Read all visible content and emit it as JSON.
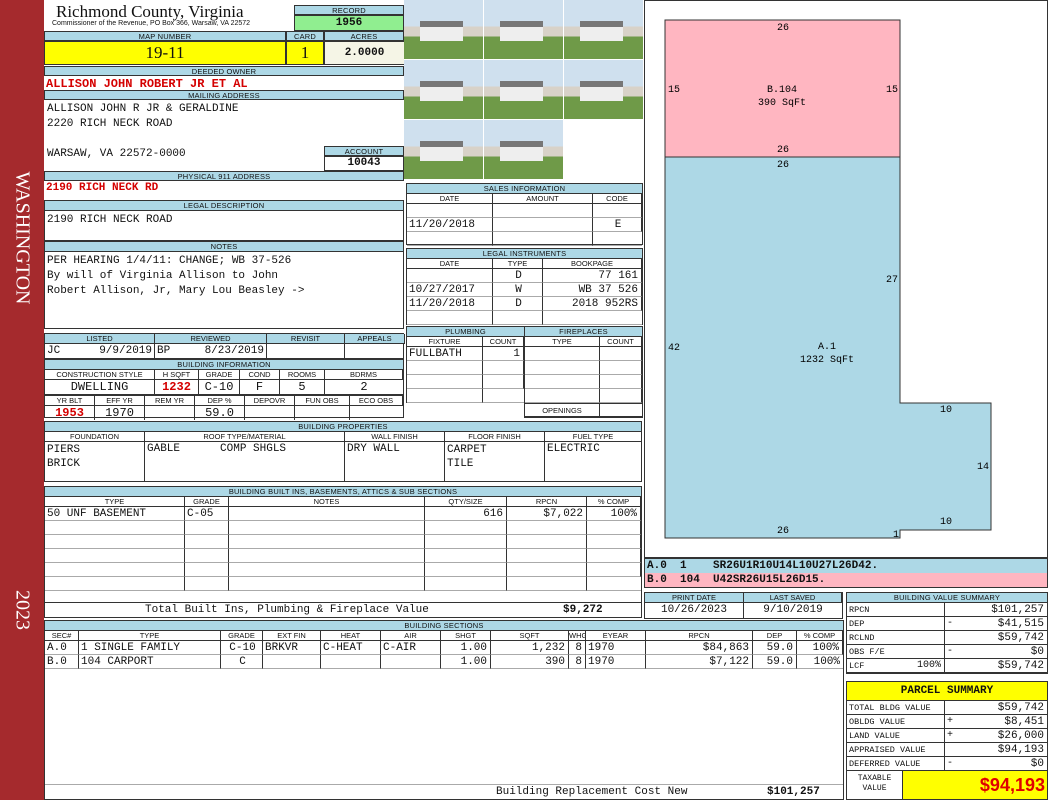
{
  "sidebar": {
    "district": "WASHINGTON",
    "year": "2023",
    "color": "#a52a2d"
  },
  "header": {
    "county": "Richmond County, Virginia",
    "office": "Commissioner of the Revenue, PO Box 366, Warsaw, VA 22572",
    "record_label": "RECORD",
    "record": "1956"
  },
  "parcel": {
    "map_label": "MAP NUMBER",
    "map": "19-11",
    "card_label": "CARD",
    "card": "1",
    "acres_label": "ACRES",
    "acres": "2.0000"
  },
  "owner": {
    "label": "DEEDED OWNER",
    "name": "ALLISON JOHN ROBERT JR ET AL"
  },
  "mailing": {
    "label": "MAILING ADDRESS",
    "line1": "ALLISON JOHN R JR & GERALDINE",
    "line2": "2220 RICH NECK ROAD",
    "line3": "WARSAW, VA 22572-0000",
    "account_label": "ACCOUNT",
    "account": "10043"
  },
  "physical": {
    "label": "PHYSICAL 911 ADDRESS",
    "value": "2190 RICH NECK RD"
  },
  "legal": {
    "label": "LEGAL DESCRIPTION",
    "value": "2190 RICH NECK ROAD"
  },
  "notes": {
    "label": "NOTES",
    "lines": [
      "PER HEARING 1/4/11: CHANGE; WB 37-526",
      "By will of Virginia Allison to John",
      "Robert Allison, Jr, Mary Lou Beasley ->"
    ]
  },
  "listing": {
    "listed_label": "LISTED",
    "reviewed_label": "REVIEWED",
    "revisit_label": "REVISIT",
    "appeals_label": "APPEALS",
    "listed_by": "JC",
    "listed": "9/9/2019",
    "reviewed_by": "BP",
    "reviewed": "8/23/2019"
  },
  "building_info": {
    "label": "BUILDING INFORMATION",
    "headers1": [
      "CONSTRUCTION STYLE",
      "H SQFT",
      "GRADE",
      "COND",
      "ROOMS",
      "BDRMS"
    ],
    "values1": [
      "DWELLING",
      "1232",
      "C-10",
      "F",
      "5",
      "2"
    ],
    "headers2": [
      "YR BLT",
      "EFF YR",
      "REM YR",
      "DEP %",
      "DEPOVR",
      "FUN OBS",
      "ECO OBS"
    ],
    "values2": [
      "1953",
      "1970",
      "",
      "59.0",
      "",
      "",
      ""
    ]
  },
  "sales": {
    "label": "SALES INFORMATION",
    "headers": [
      "DATE",
      "AMOUNT",
      "CODE"
    ],
    "rows": [
      [
        "",
        "",
        ""
      ],
      [
        "11/20/2018",
        "",
        "E"
      ]
    ]
  },
  "instruments": {
    "label": "LEGAL INSTRUMENTS",
    "headers": [
      "DATE",
      "TYPE",
      "BOOKPAGE"
    ],
    "rows": [
      [
        "",
        "D",
        "77 161"
      ],
      [
        "10/27/2017",
        "W",
        "WB 37 526"
      ],
      [
        "11/20/2018",
        "D",
        "2018 952RS"
      ]
    ]
  },
  "plumbing": {
    "label": "PLUMBING",
    "headers": [
      "FIXTURE",
      "COUNT"
    ],
    "rows": [
      [
        "FULLBATH",
        "1"
      ]
    ]
  },
  "fireplaces": {
    "label": "FIREPLACES",
    "headers": [
      "TYPE",
      "COUNT"
    ],
    "openings_label": "OPENINGS"
  },
  "properties": {
    "label": "BUILDING PROPERTIES",
    "headers": [
      "FOUNDATION",
      "ROOF TYPE/MATERIAL",
      "WALL FINISH",
      "FLOOR FINISH",
      "FUEL TYPE"
    ],
    "foundation": "PIERS\nBRICK",
    "roof_type": "GABLE",
    "roof_material": "COMP SHGLS",
    "wall": "DRY WALL",
    "floor": "CARPET\nTILE",
    "fuel": "ELECTRIC"
  },
  "builtins": {
    "label": "BUILDING BUILT INS, BASEMENTS, ATTICS & SUB SECTIONS",
    "headers": [
      "TYPE",
      "GRADE",
      "NOTES",
      "QTY/SIZE",
      "RPCN",
      "% COMP"
    ],
    "rows": [
      [
        "50 UNF BASEMENT",
        "C-05",
        "",
        "616",
        "$7,022",
        "100%"
      ]
    ],
    "total_label": "Total Built Ins, Plumbing & Fireplace Value",
    "total": "$9,272"
  },
  "sections": {
    "label": "BUILDING SECTIONS",
    "headers": [
      "SEC#",
      "TYPE",
      "GRADE",
      "EXT FIN",
      "HEAT",
      "AIR",
      "SHGT",
      "SQFT",
      "WHGT",
      "EYEAR",
      "RPCN",
      "DEP",
      "% COMP"
    ],
    "rows": [
      [
        "A.0",
        "1 SINGLE FAMILY",
        "C-10",
        "BRKVR",
        "C-HEAT",
        "C-AIR",
        "1.00",
        "1,232",
        "8",
        "1970",
        "$84,863",
        "59.0",
        "100%"
      ],
      [
        "B.0",
        "104 CARPORT",
        "C",
        "",
        "",
        "",
        "1.00",
        "390",
        "8",
        "1970",
        "$7,122",
        "59.0",
        "100%"
      ]
    ],
    "rcn_label": "Building Replacement Cost New",
    "rcn": "$101,257"
  },
  "sketch": {
    "areas": [
      {
        "code": "B.104",
        "sqft": "390 SqFt",
        "color": "#ffb6c1"
      },
      {
        "code": "A.1",
        "sqft": "1232 SqFt",
        "color": "#add8e6"
      }
    ],
    "dims": [
      "26",
      "15",
      "15",
      "26",
      "26",
      "27",
      "42",
      "10",
      "14",
      "10",
      "26",
      "1"
    ],
    "vectors": [
      {
        "sec": "A.0",
        "code": "1",
        "path": "SR26U1R10U14L10U27L26D42."
      },
      {
        "sec": "B.0",
        "code": "104",
        "path": "U42SR26U15L26D15."
      }
    ]
  },
  "dates": {
    "print_label": "PRINT DATE",
    "print": "10/26/2023",
    "saved_label": "LAST SAVED",
    "saved": "9/10/2019"
  },
  "value_summary": {
    "label": "BUILDING VALUE SUMMARY",
    "rows": [
      {
        "k": "RPCN",
        "op": "",
        "v": "$101,257"
      },
      {
        "k": "DEP",
        "op": "-",
        "v": "$41,515"
      },
      {
        "k": "RCLND",
        "op": "",
        "v": "$59,742"
      },
      {
        "k": "OBS F/E",
        "op": "-",
        "v": "$0"
      },
      {
        "k": "LCF",
        "pct": "100%",
        "op": "",
        "v": "$59,742"
      }
    ]
  },
  "parcel_summary": {
    "label": "PARCEL SUMMARY",
    "rows": [
      {
        "k": "TOTAL BLDG VALUE",
        "op": "",
        "v": "$59,742"
      },
      {
        "k": "OBLDG VALUE",
        "op": "+",
        "v": "$8,451"
      },
      {
        "k": "LAND VALUE",
        "op": "+",
        "v": "$26,000"
      },
      {
        "k": "APPRAISED VALUE",
        "op": "",
        "v": "$94,193"
      },
      {
        "k": "DEFERRED VALUE",
        "op": "-",
        "v": "$0"
      }
    ],
    "taxable_label": "TAXABLE VALUE",
    "taxable": "$94,193"
  }
}
